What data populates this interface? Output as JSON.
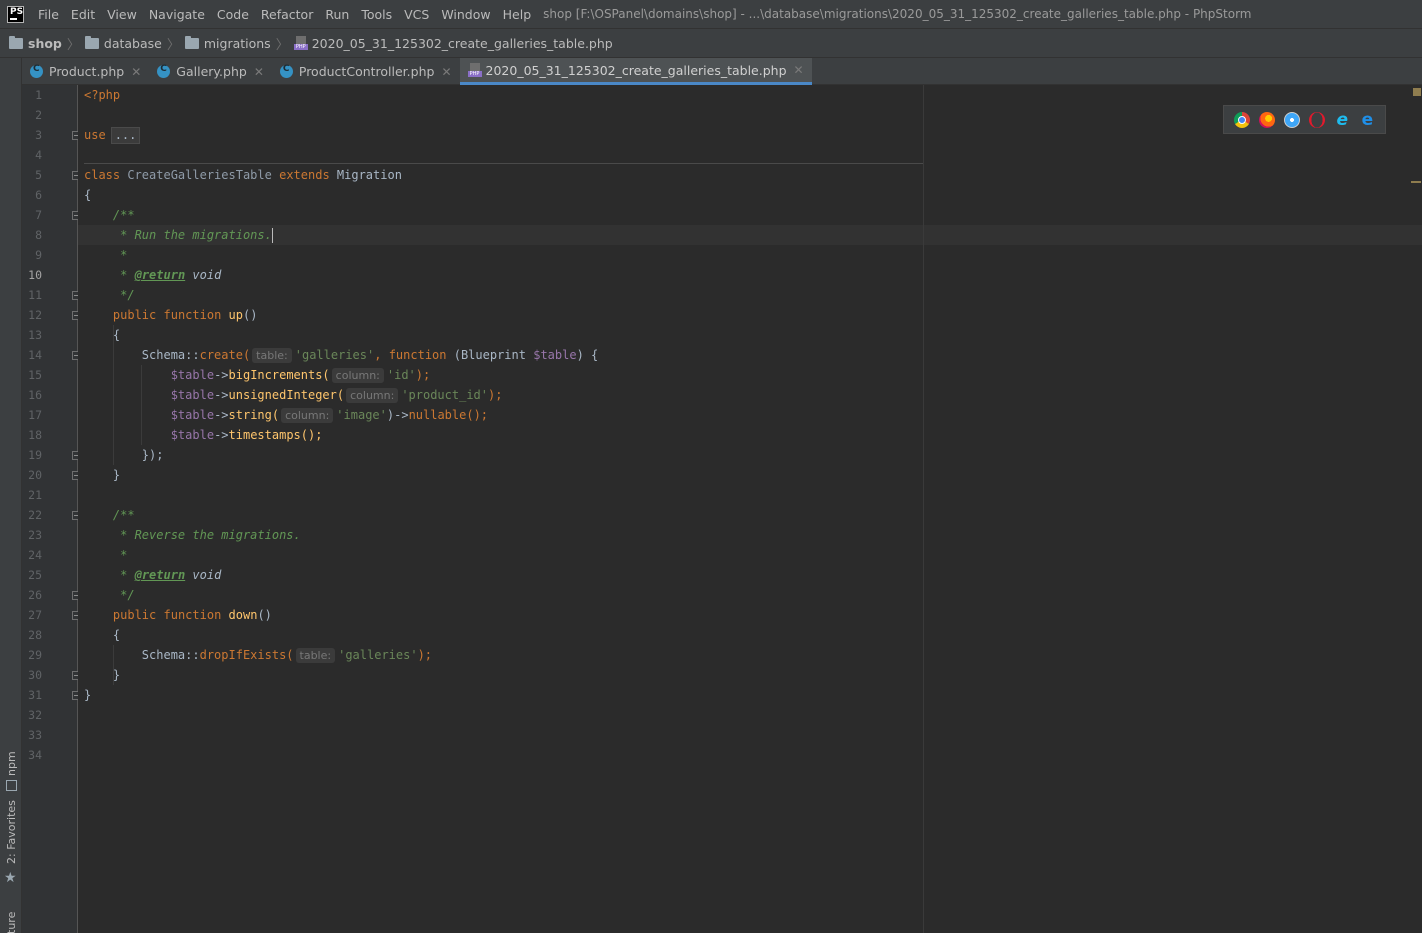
{
  "menu": {
    "items": [
      "File",
      "Edit",
      "View",
      "Navigate",
      "Code",
      "Refactor",
      "Run",
      "Tools",
      "VCS",
      "Window",
      "Help"
    ],
    "title": "shop [F:\\OSPanel\\domains\\shop] - ...\\database\\migrations\\2020_05_31_125302_create_galleries_table.php - PhpStorm"
  },
  "breadcrumb": {
    "project": "shop",
    "folder1": "database",
    "folder2": "migrations",
    "file": "2020_05_31_125302_create_galleries_table.php"
  },
  "tabs": [
    {
      "label": "Product.php",
      "icon": "class-icon"
    },
    {
      "label": "Gallery.php",
      "icon": "class-icon"
    },
    {
      "label": "ProductController.php",
      "icon": "class-icon"
    },
    {
      "label": "2020_05_31_125302_create_galleries_table.php",
      "icon": "php-file-icon",
      "active": true
    }
  ],
  "left_tools": {
    "npm": "npm",
    "favorites": "2: Favorites",
    "structure": "ture"
  },
  "editor": {
    "current_line": 10,
    "line_numbers": [
      "1",
      "2",
      "3",
      "4",
      "5",
      "6",
      "7",
      "8",
      "9",
      "10",
      "11",
      "12",
      "13",
      "14",
      "15",
      "16",
      "17",
      "18",
      "19",
      "20",
      "21",
      "22",
      "23",
      "24",
      "25",
      "26",
      "27",
      "28",
      "29",
      "30",
      "31",
      "32",
      "33",
      "34"
    ],
    "code": {
      "l1": "<?php",
      "l3_kw": "use",
      "l3_fold": "...",
      "l7_class": "class",
      "l7_name": "CreateGalleriesTable",
      "l7_extends": "extends",
      "l7_parent": "Migration",
      "brace_open": "{",
      "brace_close": "}",
      "doc_open": "/**",
      "doc_run": " * Run the migrations.",
      "doc_star": " *",
      "doc_star_prefix": " * ",
      "doc_return_tag": "@return",
      "doc_return_type": " void",
      "doc_close": " */",
      "public": "public",
      "function": "function",
      "up": "up",
      "parens": "()",
      "schema": "Schema::",
      "create": "create(",
      "hint_table": "table:",
      "galleries": "'galleries'",
      "comma": ",",
      "blueprint": "(Blueprint ",
      "table_var": "$table",
      "paren_brace": ") {",
      "arrow": "->",
      "bigIncrements": "bigIncrements(",
      "hint_column": "column:",
      "id": "'id'",
      "close_semi": ");",
      "unsignedInteger": "unsignedInteger(",
      "product_id": "'product_id'",
      "string": "string(",
      "image": "'image'",
      "close_paren": ")",
      "nullable": "nullable",
      "call_semi": "();",
      "timestamps": "timestamps();",
      "closure_end": "});",
      "doc_reverse": " * Reverse the migrations.",
      "down": "down",
      "dropIfExists": "dropIfExists("
    }
  },
  "browser_popup": [
    "chrome-icon",
    "firefox-icon",
    "safari-icon",
    "opera-icon",
    "ie-icon",
    "edge-icon"
  ]
}
